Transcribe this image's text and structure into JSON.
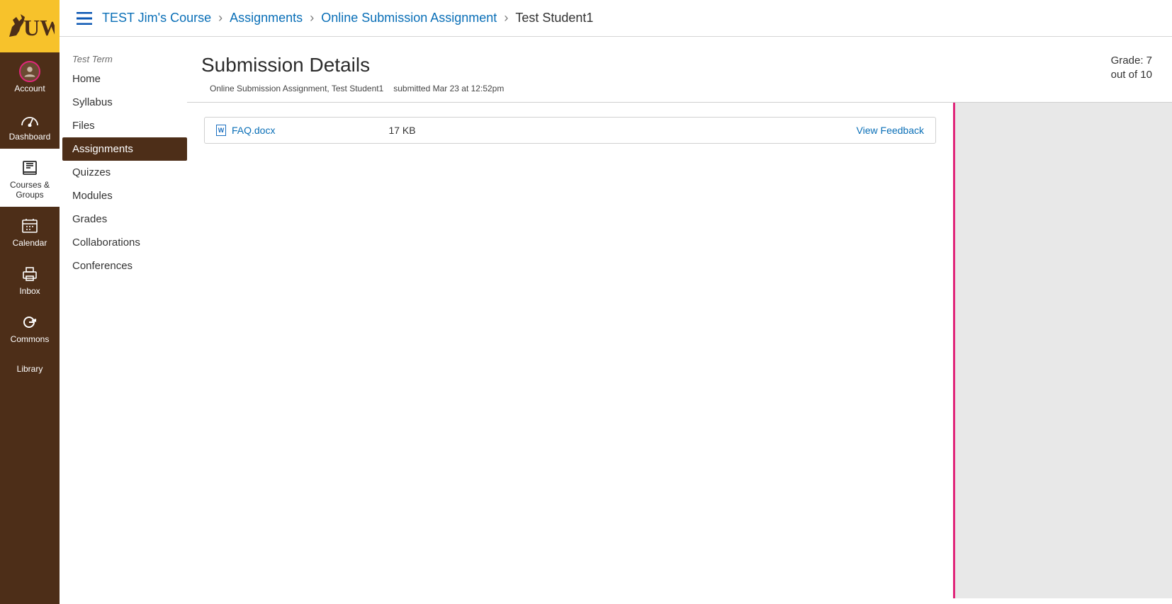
{
  "logo_text": "UW",
  "global_nav": {
    "account": "Account",
    "dashboard": "Dashboard",
    "courses": "Courses & Groups",
    "calendar": "Calendar",
    "inbox": "Inbox",
    "commons": "Commons",
    "library": "Library"
  },
  "breadcrumbs": {
    "course": "TEST Jim's Course",
    "section": "Assignments",
    "assignment": "Online Submission Assignment",
    "student": "Test Student1"
  },
  "course_nav": {
    "term": "Test Term",
    "items": {
      "home": "Home",
      "syllabus": "Syllabus",
      "files": "Files",
      "assignments": "Assignments",
      "quizzes": "Quizzes",
      "modules": "Modules",
      "grades": "Grades",
      "collaborations": "Collaborations",
      "conferences": "Conferences"
    }
  },
  "details": {
    "title": "Submission Details",
    "meta_assignment_student": "Online Submission Assignment, Test Student1",
    "meta_submitted": "submitted Mar 23 at 12:52pm",
    "grade_line1": "Grade: 7",
    "grade_line2": "out of 10"
  },
  "file": {
    "name": "FAQ.docx",
    "size": "17 KB",
    "feedback_label": "View Feedback"
  }
}
